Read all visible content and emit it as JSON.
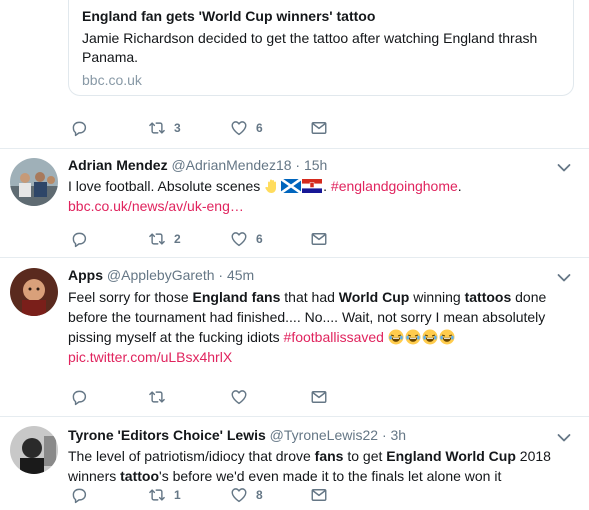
{
  "card": {
    "title": "England fan gets 'World Cup winners' tattoo",
    "description": "Jamie Richardson decided to get the tattoo after watching England thrash Panama.",
    "domain": "bbc.co.uk"
  },
  "card_actions": {
    "retweets": "3",
    "likes": "6"
  },
  "tweets": [
    {
      "name": "Adrian Mendez",
      "handle": "@AdrianMendez18",
      "sep": "·",
      "time": "15h",
      "text_a": "I love football. Absolute scenes ",
      "text_b": ". ",
      "hashtag": "#englandgoinghome",
      "text_c": ".",
      "link": "bbc.co.uk/news/av/uk-eng…",
      "retweets": "2",
      "likes": "6"
    },
    {
      "name": "Apps",
      "handle": "@ApplebyGareth",
      "sep": "·",
      "time": "45m",
      "seg1": "Feel sorry for those ",
      "b1": "England fans",
      "seg2": " that had ",
      "b2": "World Cup",
      "seg3": " winning ",
      "b3": "tattoos",
      "seg4": " done before the tournament had finished.... No.... Wait, not sorry I mean absolutely pissing myself at the fucking idiots ",
      "hashtag": "#footballissaved",
      "link": "pic.twitter.com/uLBsx4hrlX"
    },
    {
      "name": "Tyrone 'Editors Choice' Lewis",
      "handle": "@TyroneLewis22",
      "sep": "·",
      "time": "3h",
      "seg1": "The level of patriotism/idiocy that drove ",
      "b1": "fans",
      "seg2": " to get ",
      "b2": "England World Cup",
      "seg3": " 2018 winners ",
      "b3": "tattoo",
      "seg4": "'s before we'd even made it to the finals let alone won it",
      "retweets": "1",
      "likes": "8"
    }
  ],
  "colors": {
    "accent": "#e0245e",
    "muted": "#657786",
    "border": "#e6ecf0"
  },
  "icons": [
    "reply-icon",
    "retweet-icon",
    "heart-icon",
    "mail-icon",
    "caret-down-icon",
    "raised-hand-emoji",
    "scotland-flag",
    "croatia-flag",
    "laughing-emoji"
  ]
}
